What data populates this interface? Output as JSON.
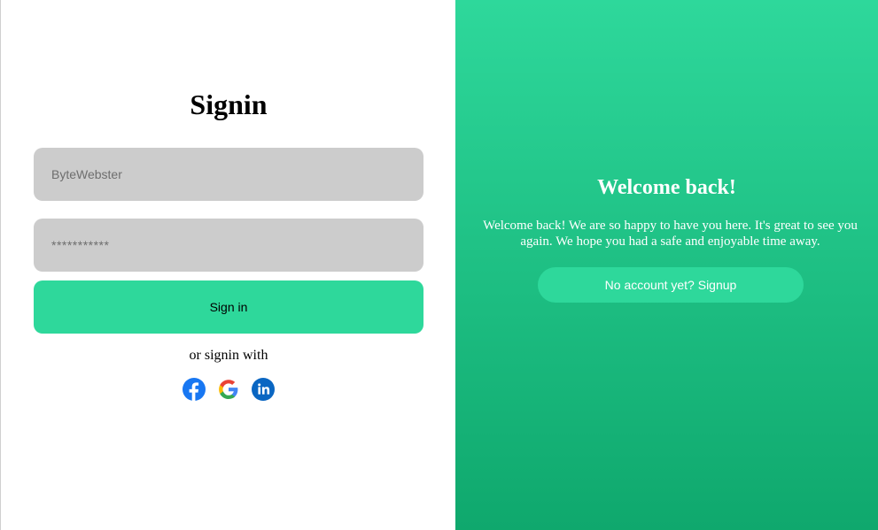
{
  "signin": {
    "title": "Signin",
    "username_value": "ByteWebster",
    "password_value": "***********",
    "button_label": "Sign in",
    "alt_text": "or signin with",
    "social": [
      "facebook-icon",
      "google-icon",
      "linkedin-icon"
    ]
  },
  "welcome": {
    "title": "Welcome back!",
    "message": "Welcome back! We are so happy to have you here. It's great to see you again. We hope you had a safe and enjoyable time away.",
    "signup_label": "No account yet? Signup"
  },
  "colors": {
    "accent": "#2ed89b",
    "panel_top": "#2ed89b",
    "panel_bottom": "#0fa86d",
    "input_bg": "#cccccc",
    "facebook": "#1877f2",
    "linkedin": "#0a66c2"
  }
}
